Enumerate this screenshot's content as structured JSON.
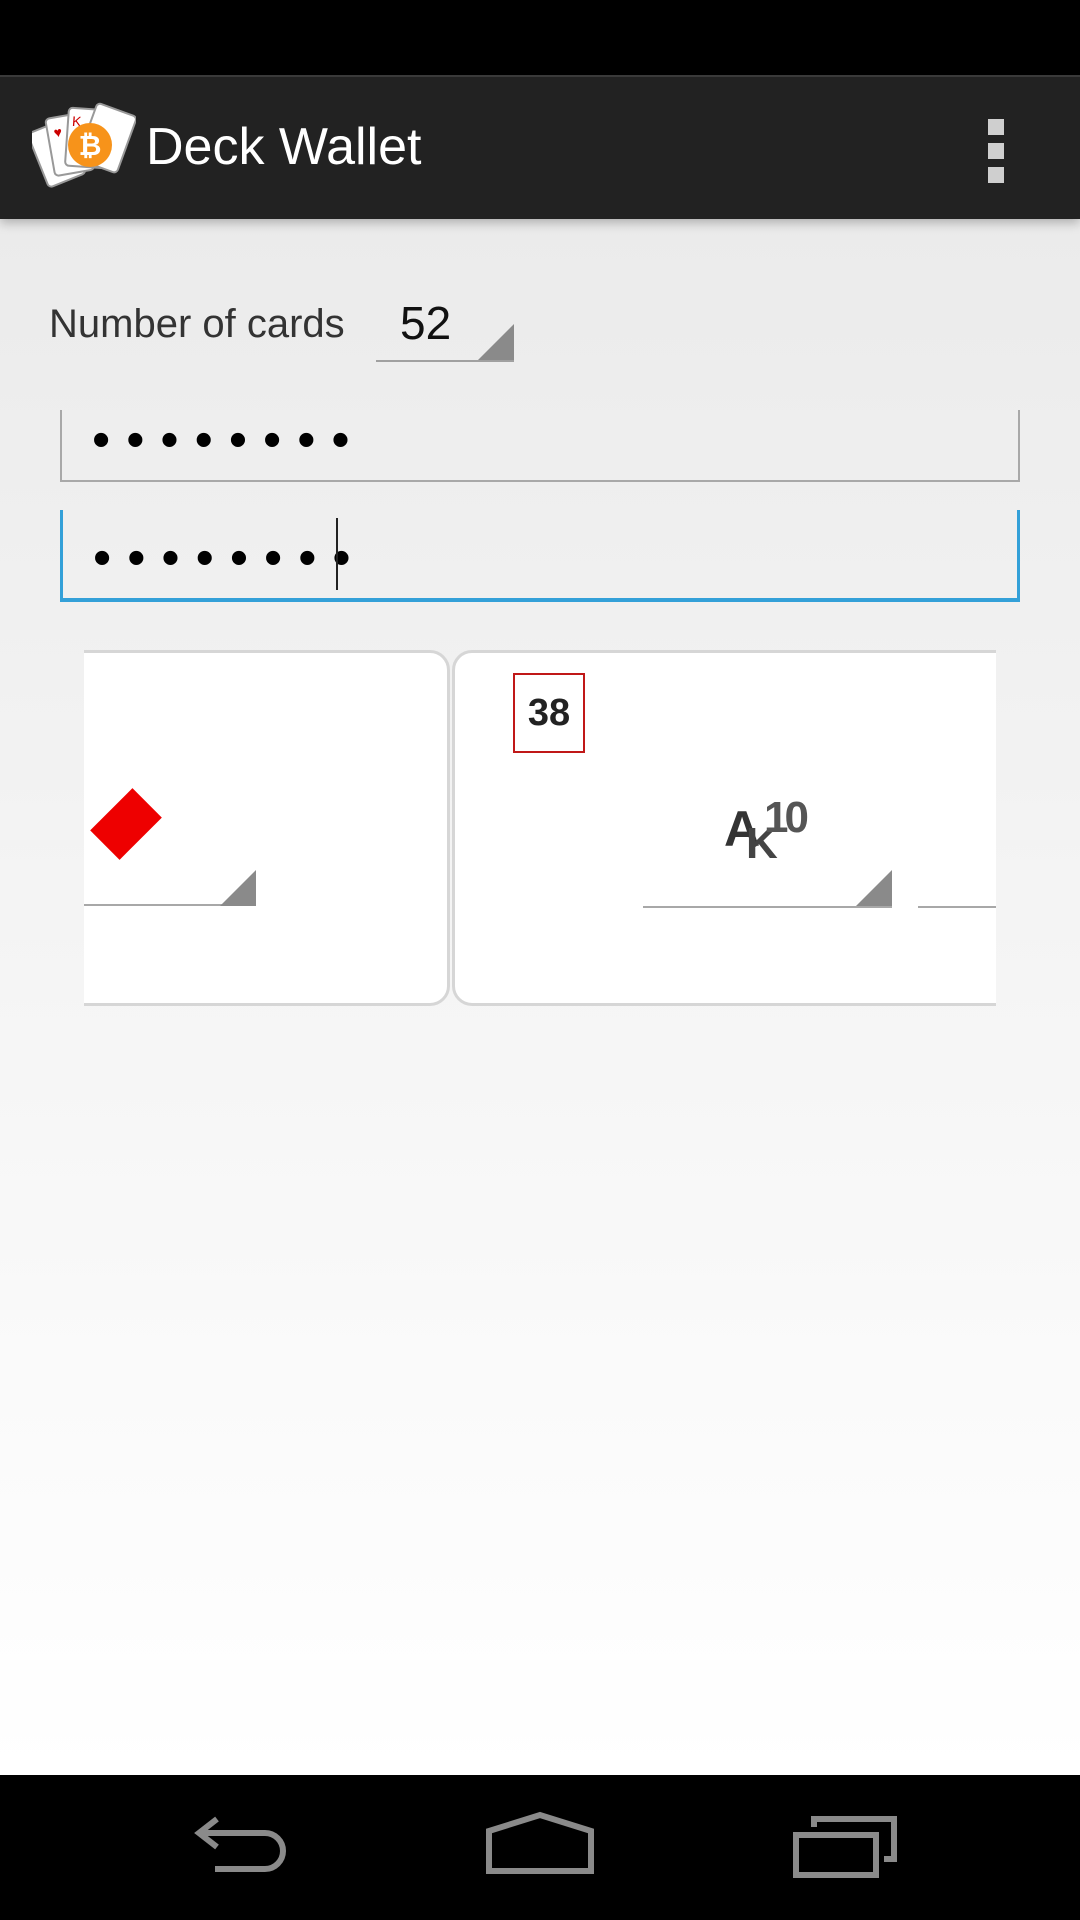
{
  "app": {
    "title": "Deck Wallet",
    "icon": "deck-of-cards-bitcoin-icon",
    "menu_icon": "overflow-menu-icon"
  },
  "form": {
    "num_cards_label": "Number of cards",
    "num_cards_value": "52",
    "password1_mask": "••••••••",
    "password2_mask": "••••••••"
  },
  "cards": {
    "left": {
      "suit_icon": "diamond-icon",
      "suit_color": "#e00000"
    },
    "right": {
      "number": "38",
      "rank_icon": "rank-selector-icon",
      "rank_labels": {
        "a": "A",
        "k": "K",
        "ten": "10"
      }
    }
  },
  "colors": {
    "accent": "#33a0d8",
    "action_bar": "#222222",
    "number_border": "#c01818"
  },
  "nav": {
    "back_icon": "back-icon",
    "home_icon": "home-icon",
    "recents_icon": "recent-apps-icon"
  }
}
